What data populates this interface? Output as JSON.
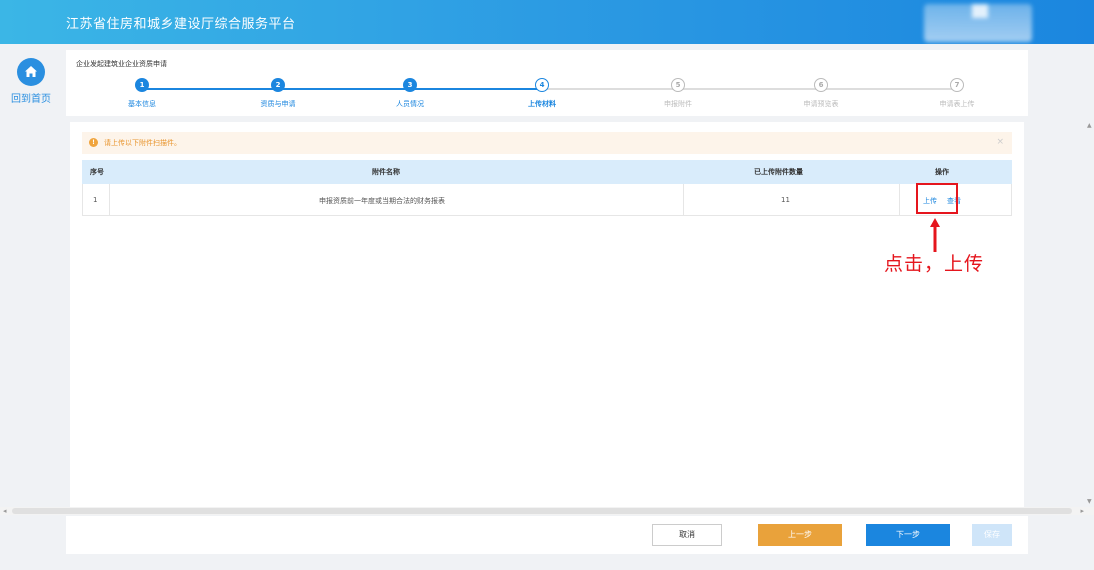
{
  "app": {
    "title": "江苏省住房和城乡建设厅综合服务平台"
  },
  "nav": {
    "home_label": "回到首页"
  },
  "breadcrumb": "企业发起建筑业企业资质申请",
  "steps": [
    {
      "num": "1",
      "label": "基本信息",
      "state": "done"
    },
    {
      "num": "2",
      "label": "资质与申请",
      "state": "done"
    },
    {
      "num": "3",
      "label": "人员情况",
      "state": "done"
    },
    {
      "num": "4",
      "label": "上传材料",
      "state": "current"
    },
    {
      "num": "5",
      "label": "申报附件",
      "state": "todo"
    },
    {
      "num": "6",
      "label": "申请预览表",
      "state": "todo"
    },
    {
      "num": "7",
      "label": "申请表上传",
      "state": "todo"
    }
  ],
  "alert": {
    "message": "请上传以下附件扫描件。",
    "close": "×"
  },
  "table": {
    "headers": {
      "index": "序号",
      "name": "附件名称",
      "count": "已上传附件数量",
      "action": "操作"
    },
    "rows": [
      {
        "index": "1",
        "name": "申报资质前一年度或当期合法的财务报表",
        "count": "11",
        "upload": "上传",
        "view": "查看"
      }
    ]
  },
  "annotation": {
    "text": "点击，上传"
  },
  "footer": {
    "cancel": "取消",
    "prev": "上一步",
    "next": "下一步",
    "save": "保存"
  },
  "colors": {
    "primary": "#1b86df",
    "warning": "#e9a23b",
    "annotation": "#e5151d"
  }
}
